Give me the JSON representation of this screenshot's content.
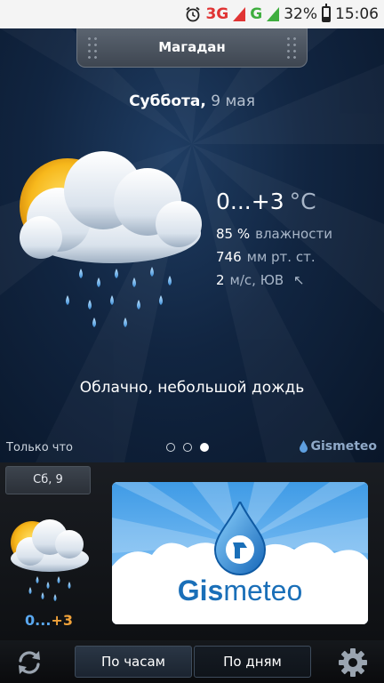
{
  "status_bar": {
    "network_3g": "3G",
    "network_g": "G",
    "battery": "32%",
    "time": "15:06"
  },
  "header": {
    "city": "Магадан"
  },
  "current": {
    "day_of_week": "Суббота,",
    "date": "9 мая",
    "temperature": "0...+3",
    "temperature_unit": "°C",
    "humidity_value": "85 %",
    "humidity_label": "влажности",
    "pressure_value": "746",
    "pressure_label": "мм рт. ст.",
    "wind_value": "2",
    "wind_label": "м/с, ЮВ",
    "wind_arrow": "↖",
    "description": "Облачно, небольшой дождь",
    "updated": "Только что",
    "page_count": 3,
    "active_page": 3,
    "brand": "Gismeteo"
  },
  "forecast": {
    "day_label": "Сб, 9",
    "temp_min": "0",
    "temp_sep": "...",
    "temp_max": "+3"
  },
  "ad": {
    "brand_prefix": "Gis",
    "brand_suffix": "meteo"
  },
  "toolbar": {
    "by_hours": "По часам",
    "by_days": "По дням"
  },
  "colors": {
    "accent_blue": "#1a6fb8",
    "warm": "#f0a23a",
    "cold": "#5aa8f0",
    "panel": "#112541"
  },
  "icons": [
    "alarm-icon",
    "signal-icon",
    "battery-icon",
    "cloud-rain-sun-icon",
    "wind-arrow-icon",
    "gismeteo-drop-icon",
    "refresh-icon",
    "gear-icon"
  ]
}
